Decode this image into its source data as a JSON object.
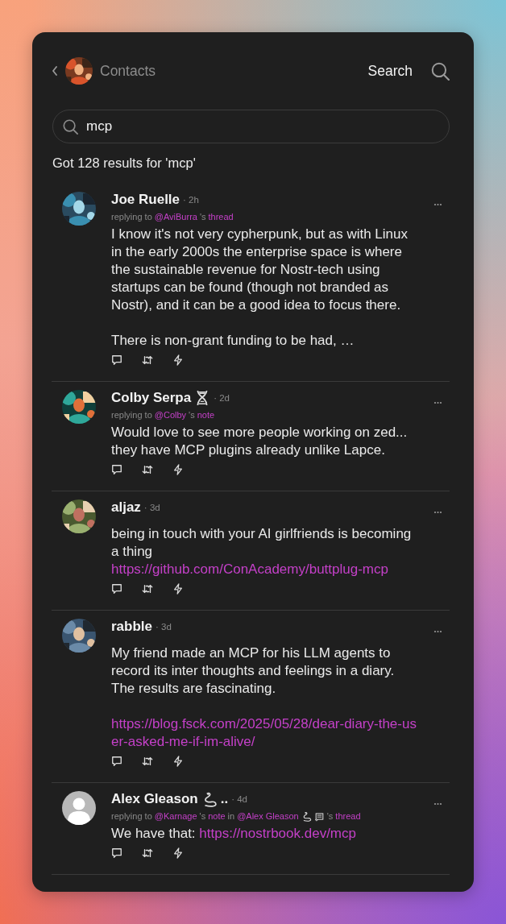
{
  "header": {
    "back_label": "Contacts",
    "title": "Search"
  },
  "search": {
    "value": "mcp"
  },
  "results_text": "Got 128 results for 'mcp'",
  "notes": [
    {
      "author": "Joe Ruelle",
      "time": "· 2h",
      "avatar": {
        "kind": "picture"
      },
      "reply": [
        {
          "kind": "plain",
          "text": "replying to"
        },
        {
          "kind": "link",
          "text": "@AviBurra"
        },
        {
          "kind": "plain",
          "text": "'s"
        },
        {
          "kind": "link",
          "text": "thread"
        }
      ],
      "body": [
        {
          "kind": "text",
          "text": "I know it's not very cypherpunk, but as with Linux in the early 2000s the enterprise space is where the sustainable revenue for Nostr-tech using startups can be found (though not branded as Nostr), and it can be a good idea to focus there.\n\nThere is non-grant funding to be had, …"
        }
      ]
    },
    {
      "author": "Colby Serpa",
      "badges": [
        {
          "kind": "dna"
        }
      ],
      "time": "· 2d",
      "avatar": {
        "kind": "picture"
      },
      "reply": [
        {
          "kind": "plain",
          "text": "replying to"
        },
        {
          "kind": "link",
          "text": "@Colby"
        },
        {
          "kind": "plain",
          "text": "'s"
        },
        {
          "kind": "link",
          "text": "note"
        }
      ],
      "body": [
        {
          "kind": "text",
          "text": "Would love to see more people working on zed... they have MCP plugins already unlike Lapce."
        }
      ]
    },
    {
      "author": "aljaz",
      "time": "· 3d",
      "avatar": {
        "kind": "picture"
      },
      "body": [
        {
          "kind": "text",
          "text": "being in touch with your AI girlfriends is becoming a thing\n"
        },
        {
          "kind": "link",
          "text": "https://github.com/ConAcademy/buttplug-mcp"
        }
      ]
    },
    {
      "author": "rabble",
      "time": "· 3d",
      "avatar": {
        "kind": "picture"
      },
      "body": [
        {
          "kind": "text",
          "text": "My friend made an MCP for his LLM agents to record its inter thoughts and feelings in a diary. The results are fascinating.\n\n"
        },
        {
          "kind": "link",
          "text": "https://blog.fsck.com/2025/05/28/dear-diary-the-user-asked-me-if-im-alive/"
        }
      ]
    },
    {
      "author": "Alex Gleason",
      "badges": [
        {
          "kind": "snake"
        }
      ],
      "name_suffix": "..",
      "time": "· 4d",
      "avatar": {
        "kind": "silhouette"
      },
      "reply": [
        {
          "kind": "plain",
          "text": "replying to"
        },
        {
          "kind": "link",
          "text": "@Karnage"
        },
        {
          "kind": "plain",
          "text": "'s"
        },
        {
          "kind": "link",
          "text": "note"
        },
        {
          "kind": "plain",
          "text": "in"
        },
        {
          "kind": "link",
          "text": "@Alex Gleason"
        },
        {
          "kind": "snake"
        },
        {
          "kind": "scroll"
        },
        {
          "kind": "plain",
          "text": "'s"
        },
        {
          "kind": "link",
          "text": "thread"
        }
      ],
      "body": [
        {
          "kind": "text",
          "text": "We have that: "
        },
        {
          "kind": "link",
          "text": "https://nostrbook.dev/mcp"
        }
      ]
    }
  ]
}
